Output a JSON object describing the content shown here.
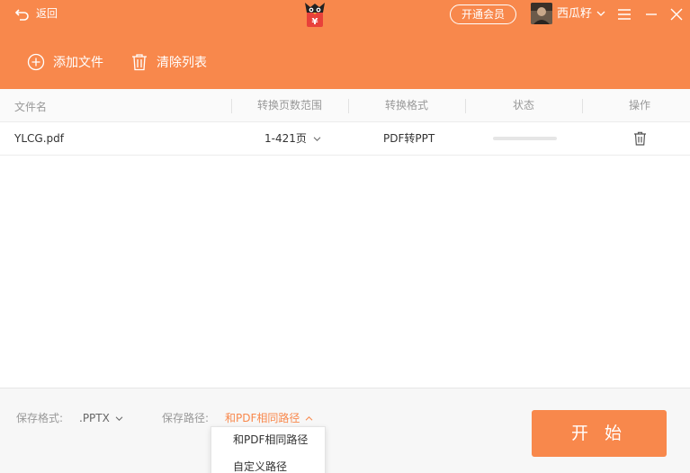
{
  "header": {
    "back_label": "返回",
    "vip_button": "开通会员",
    "username": "西瓜籽",
    "logo_glyph": "¥",
    "brand_color": "#f8884c"
  },
  "toolbar": {
    "add_files_label": "添加文件",
    "clear_list_label": "清除列表"
  },
  "table": {
    "columns": [
      "文件名",
      "转换页数范围",
      "转换格式",
      "状态",
      "操作"
    ],
    "rows": [
      {
        "file_name": "YLCG.pdf",
        "page_range": "1-421页",
        "format": "PDF转PPT",
        "progress": 0
      }
    ]
  },
  "footer": {
    "save_format_label": "保存格式:",
    "save_format_value": ".PPTX",
    "save_path_label": "保存路径:",
    "save_path_value": "和PDF相同路径",
    "start_button": "开 始"
  },
  "dropdown": {
    "options": [
      "和PDF相同路径",
      "自定义路径"
    ]
  },
  "icons": {
    "back": "back-arrow-icon",
    "add": "plus-circle-icon",
    "clear": "trash-icon",
    "menu": "hamburger-menu-icon",
    "minimize": "minimize-icon",
    "close": "close-icon"
  }
}
